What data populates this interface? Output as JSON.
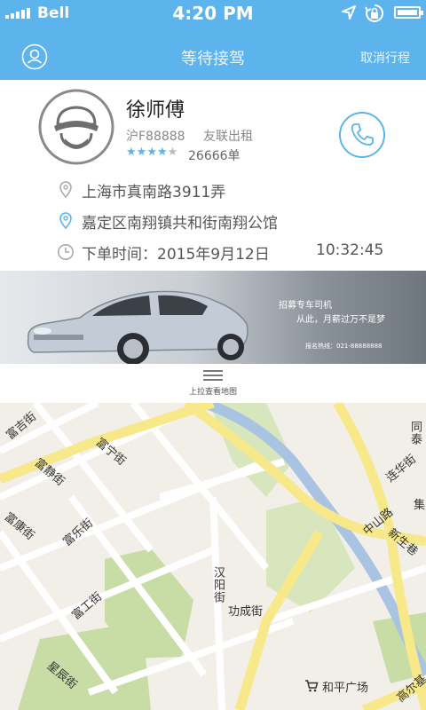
{
  "status_bar": {
    "carrier": "Bell",
    "time": "4:20 PM",
    "battery_level": 1.0
  },
  "nav": {
    "title": "等待接驾",
    "cancel_label": "取消行程",
    "user_icon": "user-icon"
  },
  "driver": {
    "name": "徐师傅",
    "plate": "沪F88888",
    "company": "友联出租",
    "rating": 4,
    "rating_max": 5,
    "orders": "26666单",
    "call_icon": "phone-icon"
  },
  "trip": {
    "pickup": "上海市真南路3911弄",
    "destination": "嘉定区南翔镇共和街南翔公馆",
    "order_time_label": "下单时间：2015年9月12日",
    "order_time_clock": "10:32:45"
  },
  "banner": {
    "title": "招募专车司机",
    "slogan": "从此，月薪过万不是梦",
    "hotline": "报名热线：021-88888888"
  },
  "pull_up": {
    "label": "上拉查看地图"
  },
  "map": {
    "streets": [
      "富吉街",
      "富宁街",
      "富静街",
      "富康街",
      "富乐街",
      "富工街",
      "汉阳街",
      "功成街",
      "星辰街",
      "中山路",
      "连华街",
      "新生巷",
      "高尔基",
      "同泰",
      "集"
    ],
    "poi": "和平广场",
    "colors": {
      "road_major": "#f7e98a",
      "road_minor": "#ffffff",
      "park": "#c8dca6",
      "river": "#a9c3e3",
      "background": "#f2eee8"
    }
  },
  "colors": {
    "accent": "#5db4ec"
  }
}
